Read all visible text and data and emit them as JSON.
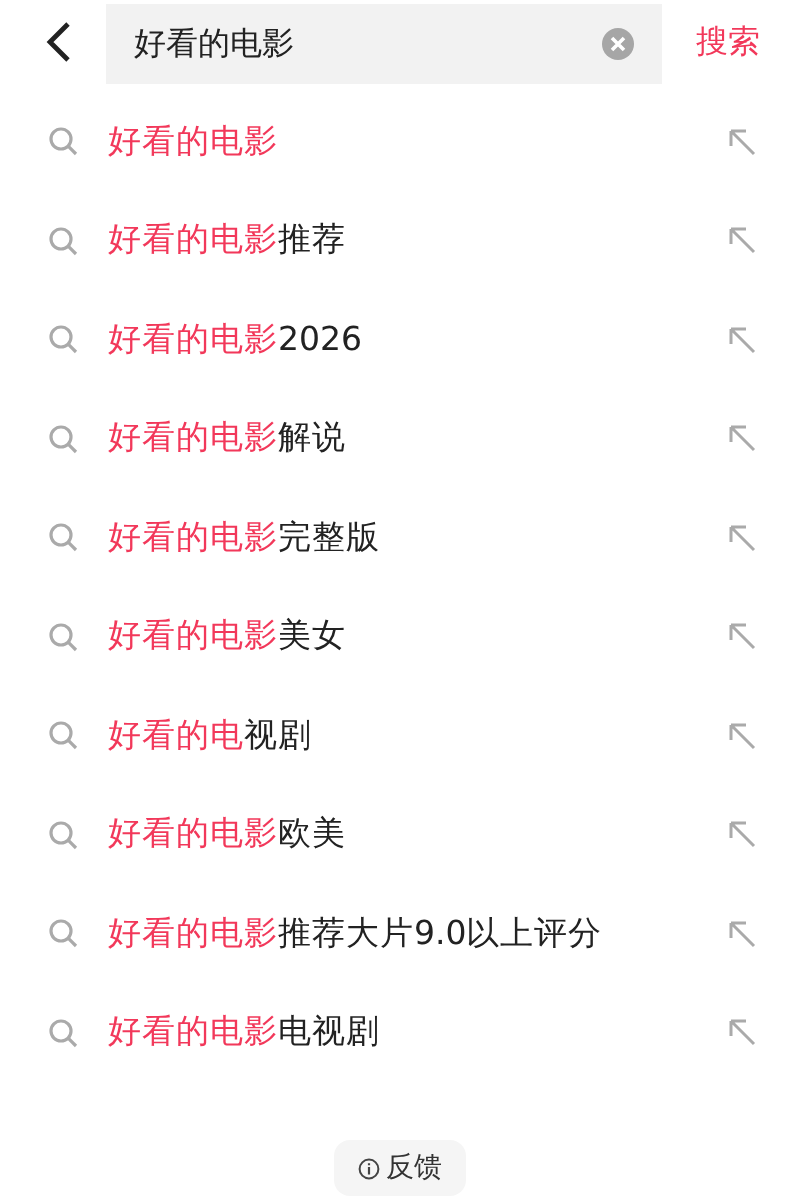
{
  "search": {
    "value": "好看的电影",
    "action": "搜索"
  },
  "suggestions": [
    {
      "highlight": "好看的电影"
    },
    {
      "highlight": "好看的电影",
      "rest": "推荐"
    },
    {
      "highlight": "好看的电影",
      "rest": "2026"
    },
    {
      "highlight": "好看的电影",
      "rest": "解说"
    },
    {
      "highlight": "好看的电影",
      "rest": "完整版"
    },
    {
      "highlight": "好看的电影",
      "rest": "美女"
    },
    {
      "highlight": "好看的电",
      "rest": "视剧"
    },
    {
      "highlight": "好看的电影",
      "rest": "欧美"
    },
    {
      "highlight": "好看的电影",
      "rest": "推荐大片9.0以上评分"
    },
    {
      "highlight": "好看的电影",
      "rest": "电视剧"
    }
  ],
  "feedback": "反馈"
}
